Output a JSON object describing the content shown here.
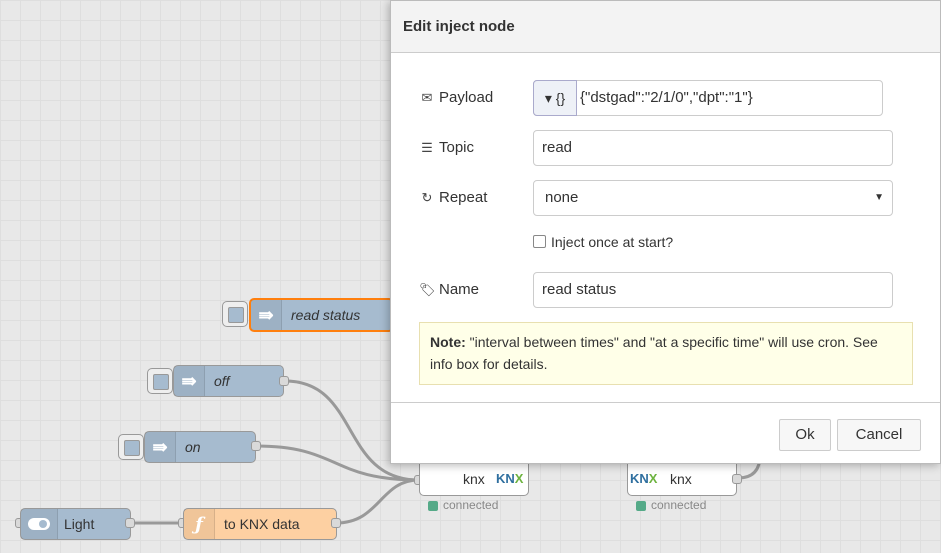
{
  "flow": {
    "nodes": {
      "read_status": {
        "label": "read status",
        "icon": "arrow-right-icon"
      },
      "off": {
        "label": "off",
        "icon": "arrow-right-icon"
      },
      "on": {
        "label": "on",
        "icon": "arrow-right-icon"
      },
      "light": {
        "label": "Light",
        "icon": "toggle-icon"
      },
      "to_knx": {
        "label": "to KNX data",
        "icon": "function-icon"
      },
      "knx_out": {
        "label": "knx",
        "logo": "KNX",
        "status": "connected"
      },
      "knx_in": {
        "label": "knx",
        "logo": "KNX",
        "status": "connected"
      }
    }
  },
  "dialog": {
    "title": "Edit inject node",
    "payload": {
      "label": "Payload",
      "type_symbol": "{}",
      "value": "{\"dstgad\":\"2/1/0\",\"dpt\":\"1\"}",
      "icon": "envelope-icon"
    },
    "topic": {
      "label": "Topic",
      "value": "read",
      "icon": "tasks-icon"
    },
    "repeat": {
      "label": "Repeat",
      "value": "none",
      "icon": "repeat-icon"
    },
    "inject_once": {
      "label": "Inject once at start?",
      "checked": false
    },
    "name": {
      "label": "Name",
      "value": "read status",
      "icon": "tag-icon"
    },
    "note": {
      "title": "Note:",
      "text": "\"interval between times\" and \"at a specific time\" will use cron. See info box for details."
    },
    "ok_label": "Ok",
    "cancel_label": "Cancel"
  },
  "colors": {
    "inject": "#a6bbcf",
    "function": "#fdd0a2",
    "selected": "#ff7f0e",
    "status_ok": "#5a8"
  }
}
